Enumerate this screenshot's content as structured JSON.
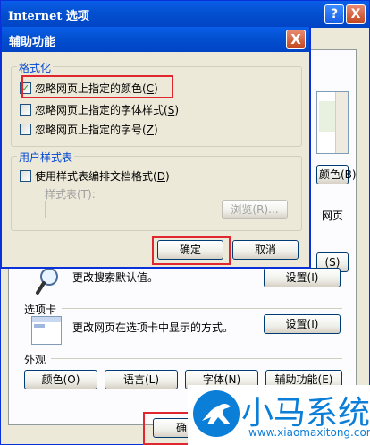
{
  "window": {
    "title": "Internet 选项",
    "help_glyph": "?",
    "close_glyph": "X"
  },
  "bg": {
    "button_b": "颜色(B)",
    "side_fragment_1": "网页",
    "button_s": "(S)",
    "search_desc": "更改搜索默认值。",
    "search_settings": "设置(I)",
    "tabs_section": "选项卡",
    "tabs_desc": "更改网页在选项卡中显示的方式。",
    "tabs_settings": "设置(I)",
    "appearance_section": "外观",
    "appearance_buttons": [
      "颜色(O)",
      "语言(L)",
      "字体(N)",
      "辅助功能(E)"
    ],
    "ok_partial": "确定"
  },
  "dialog": {
    "title": "辅助功能",
    "close_glyph": "X",
    "format_group": "格式化",
    "checks": [
      {
        "label": "忽略网页上指定的颜色",
        "key": "C",
        "checked": true,
        "mark": "✓"
      },
      {
        "label": "忽略网页上指定的字体样式",
        "key": "S",
        "checked": false,
        "mark": ""
      },
      {
        "label": "忽略网页上指定的字号",
        "key": "Z",
        "checked": false,
        "mark": ""
      }
    ],
    "user_group": "用户样式表",
    "user_check": {
      "label": "使用样式表编排文档格式",
      "key": "D",
      "checked": false,
      "mark": ""
    },
    "stylesheet_label": "样式表(T):",
    "stylesheet_value": "",
    "browse": "浏览(R)...",
    "ok": "确定",
    "cancel": "取消"
  },
  "watermark": {
    "text": "小马系统",
    "url": "www.xiaomaxitong.com"
  },
  "colors": {
    "accent": "#0831d9",
    "highlight": "#e0262e",
    "group_title": "#0046d5"
  }
}
